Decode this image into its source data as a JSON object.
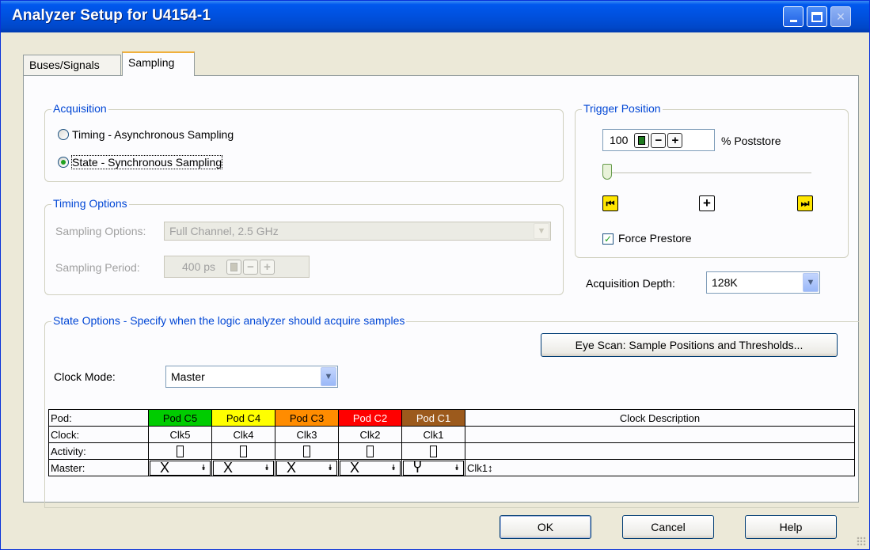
{
  "window": {
    "title": "Analyzer Setup for U4154-1"
  },
  "tabs": [
    {
      "label": "Buses/Signals"
    },
    {
      "label": "Sampling"
    }
  ],
  "acquisition": {
    "legend": "Acquisition",
    "options": [
      {
        "label": "Timing - Asynchronous Sampling",
        "selected": false
      },
      {
        "label": "State - Synchronous Sampling",
        "selected": true
      }
    ]
  },
  "timing_options": {
    "legend": "Timing Options",
    "sampling_options_label": "Sampling Options:",
    "sampling_options_value": "Full Channel, 2.5  GHz",
    "sampling_period_label": "Sampling Period:",
    "sampling_period_value": "400 ps"
  },
  "trigger_position": {
    "legend": "Trigger Position",
    "value": "100",
    "unit": "% Poststore",
    "slider_fraction": 0.0,
    "force_prestore_label": "Force Prestore",
    "force_prestore_checked": true
  },
  "acquisition_depth": {
    "label": "Acquisition Depth:",
    "value": "128K"
  },
  "state_options": {
    "legend": "State Options - Specify when the logic analyzer should acquire samples",
    "eye_scan_label": "Eye Scan: Sample Positions and Thresholds...",
    "clock_mode_label": "Clock Mode:",
    "clock_mode_value": "Master"
  },
  "clock_table": {
    "row_headers": [
      "Pod:",
      "Clock:",
      "Activity:",
      "Master:"
    ],
    "description_header": "Clock Description",
    "pods": [
      {
        "name": "Pod C5",
        "clock": "Clk5",
        "color": "#00cc00",
        "text_color": "#000000",
        "master_symbol": "X"
      },
      {
        "name": "Pod C4",
        "clock": "Clk4",
        "color": "#ffff00",
        "text_color": "#000000",
        "master_symbol": "X"
      },
      {
        "name": "Pod C3",
        "clock": "Clk3",
        "color": "#ff8c00",
        "text_color": "#000000",
        "master_symbol": "X"
      },
      {
        "name": "Pod C2",
        "clock": "Clk2",
        "color": "#ff0000",
        "text_color": "#ffffff",
        "master_symbol": "X"
      },
      {
        "name": "Pod C1",
        "clock": "Clk1",
        "color": "#9c5a1c",
        "text_color": "#ffffff",
        "master_symbol": "Ⴤ"
      }
    ],
    "master_description": "Clk1↕"
  },
  "buttons": {
    "ok": "OK",
    "cancel": "Cancel",
    "help": "Help"
  }
}
